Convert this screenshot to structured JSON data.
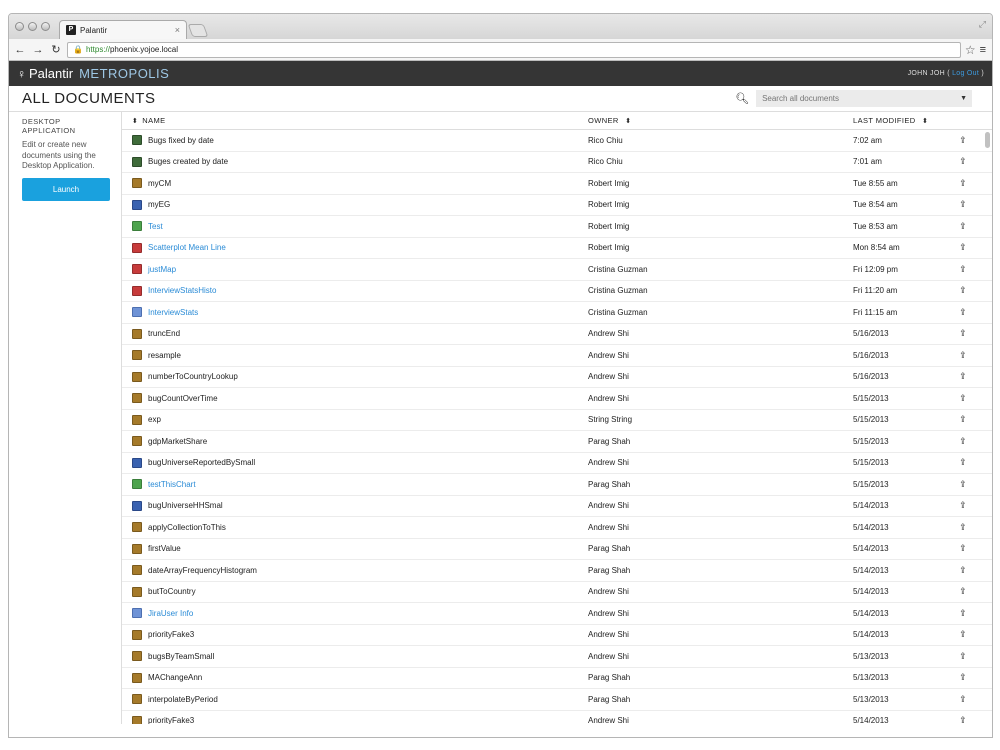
{
  "browser": {
    "tab_title": "Palantir",
    "tab_close": "×",
    "url_scheme": "https://",
    "url_host": "phoenix.yojoe.local"
  },
  "app": {
    "brand": "Palantir",
    "product": "METROPOLIS",
    "user": "JOHN JOH (",
    "logout": "Log Out",
    "user_suffix": ")"
  },
  "page": {
    "title": "ALL DOCUMENTS",
    "search_placeholder": "Search all documents"
  },
  "sidebar": {
    "heading": "DESKTOP APPLICATION",
    "description": "Edit or create new documents using the Desktop Application.",
    "launch_label": "Launch"
  },
  "table": {
    "headers": {
      "name": "NAME",
      "owner": "OWNER",
      "modified": "LAST MODIFIED"
    },
    "rows": [
      {
        "name": "Bugs fixed by date",
        "owner": "Rico Chiu",
        "modified": "7:02 am",
        "icon": "scatter-icon",
        "link": false
      },
      {
        "name": "Buges created by date",
        "owner": "Rico Chiu",
        "modified": "7:01 am",
        "icon": "scatter-icon",
        "link": false
      },
      {
        "name": "myCM",
        "owner": "Robert Imig",
        "modified": "Tue 8:55 am",
        "icon": "script-icon",
        "link": false
      },
      {
        "name": "myEG",
        "owner": "Robert Imig",
        "modified": "Tue 8:54 am",
        "icon": "visualization-icon",
        "link": false
      },
      {
        "name": "Test",
        "owner": "Robert Imig",
        "modified": "Tue 8:53 am",
        "icon": "line-chart-icon",
        "link": true
      },
      {
        "name": "Scatterplot Mean Line",
        "owner": "Robert Imig",
        "modified": "Mon 8:54 am",
        "icon": "map-icon",
        "link": true
      },
      {
        "name": "justMap",
        "owner": "Cristina Guzman",
        "modified": "Fri 12:09 pm",
        "icon": "map-icon",
        "link": true
      },
      {
        "name": "InterviewStatsHisto",
        "owner": "Cristina Guzman",
        "modified": "Fri 11:20 am",
        "icon": "map-icon",
        "link": true
      },
      {
        "name": "InterviewStats",
        "owner": "Cristina Guzman",
        "modified": "Fri 11:15 am",
        "icon": "table-icon",
        "link": true
      },
      {
        "name": "truncEnd",
        "owner": "Andrew Shi",
        "modified": "5/16/2013",
        "icon": "script-icon",
        "link": false
      },
      {
        "name": "resample",
        "owner": "Andrew Shi",
        "modified": "5/16/2013",
        "icon": "script-icon",
        "link": false
      },
      {
        "name": "numberToCountryLookup",
        "owner": "Andrew Shi",
        "modified": "5/16/2013",
        "icon": "script-icon",
        "link": false
      },
      {
        "name": "bugCountOverTime",
        "owner": "Andrew Shi",
        "modified": "5/15/2013",
        "icon": "script-icon",
        "link": false
      },
      {
        "name": "exp",
        "owner": "String String",
        "modified": "5/15/2013",
        "icon": "script-icon",
        "link": false
      },
      {
        "name": "gdpMarketShare",
        "owner": "Parag Shah",
        "modified": "5/15/2013",
        "icon": "script-icon",
        "link": false
      },
      {
        "name": "bugUniverseReportedBySmall",
        "owner": "Andrew Shi",
        "modified": "5/15/2013",
        "icon": "visualization-icon",
        "link": false
      },
      {
        "name": "testThisChart",
        "owner": "Parag Shah",
        "modified": "5/15/2013",
        "icon": "line-chart-icon",
        "link": true
      },
      {
        "name": "bugUniverseHHSmal",
        "owner": "Andrew Shi",
        "modified": "5/14/2013",
        "icon": "visualization-icon",
        "link": false
      },
      {
        "name": "applyCollectionToThis",
        "owner": "Andrew Shi",
        "modified": "5/14/2013",
        "icon": "script-icon",
        "link": false
      },
      {
        "name": "firstValue",
        "owner": "Parag Shah",
        "modified": "5/14/2013",
        "icon": "script-icon",
        "link": false
      },
      {
        "name": "dateArrayFrequencyHistogram",
        "owner": "Parag Shah",
        "modified": "5/14/2013",
        "icon": "script-icon",
        "link": false
      },
      {
        "name": "butToCountry",
        "owner": "Andrew Shi",
        "modified": "5/14/2013",
        "icon": "script-icon",
        "link": false
      },
      {
        "name": "JiraUser Info",
        "owner": "Andrew Shi",
        "modified": "5/14/2013",
        "icon": "table-icon",
        "link": true
      },
      {
        "name": "priorityFake3",
        "owner": "Andrew Shi",
        "modified": "5/14/2013",
        "icon": "script-icon",
        "link": false
      },
      {
        "name": "bugsByTeamSmall",
        "owner": "Andrew Shi",
        "modified": "5/13/2013",
        "icon": "script-icon",
        "link": false
      },
      {
        "name": "MAChangeAnn",
        "owner": "Parag Shah",
        "modified": "5/13/2013",
        "icon": "script-icon",
        "link": false
      },
      {
        "name": "interpolateByPeriod",
        "owner": "Parag Shah",
        "modified": "5/13/2013",
        "icon": "script-icon",
        "link": false
      },
      {
        "name": "priorityFake3",
        "owner": "Andrew Shi",
        "modified": "5/14/2013",
        "icon": "script-icon",
        "link": false
      }
    ]
  }
}
